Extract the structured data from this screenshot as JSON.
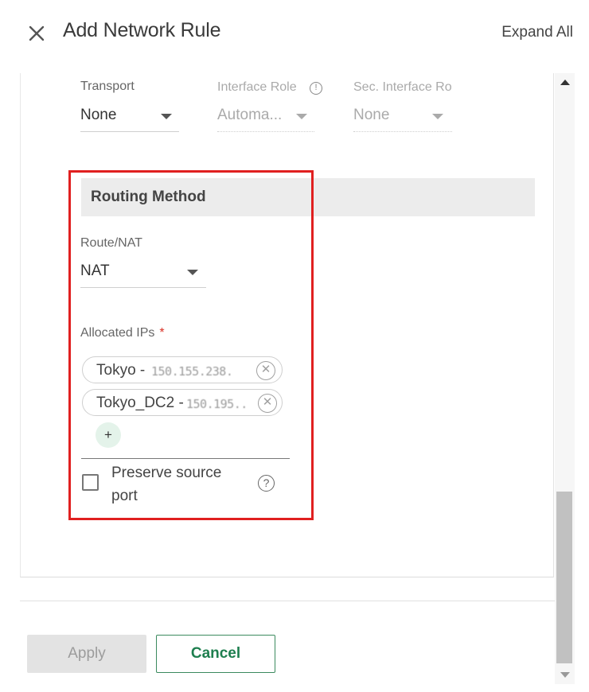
{
  "header": {
    "title": "Add Network Rule",
    "expand_all_label": "Expand All",
    "close_icon": "close-icon"
  },
  "fields": {
    "transport": {
      "label": "Transport",
      "value": "None"
    },
    "interface_role": {
      "label": "Interface Role",
      "value": "Automa..."
    },
    "sec_interface_role": {
      "label": "Sec. Interface Ro",
      "value": "None"
    }
  },
  "routing": {
    "section_title": "Routing Method",
    "route_nat": {
      "label": "Route/NAT",
      "value": "NAT"
    },
    "allocated_ips": {
      "label": "Allocated IPs",
      "required_mark": "*",
      "chips": [
        {
          "name": "Tokyo -",
          "ip": "150.155.238."
        },
        {
          "name": "Tokyo_DC2 -",
          "ip": "150.195.."
        }
      ],
      "add_label": "+"
    },
    "preserve_source_port": {
      "label": "Preserve source port",
      "checked": false,
      "help_glyph": "?"
    }
  },
  "footer": {
    "apply_label": "Apply",
    "cancel_label": "Cancel"
  },
  "colors": {
    "highlight": "#e02020",
    "accent_green": "#1e7f4f",
    "section_bg": "#ececec"
  }
}
